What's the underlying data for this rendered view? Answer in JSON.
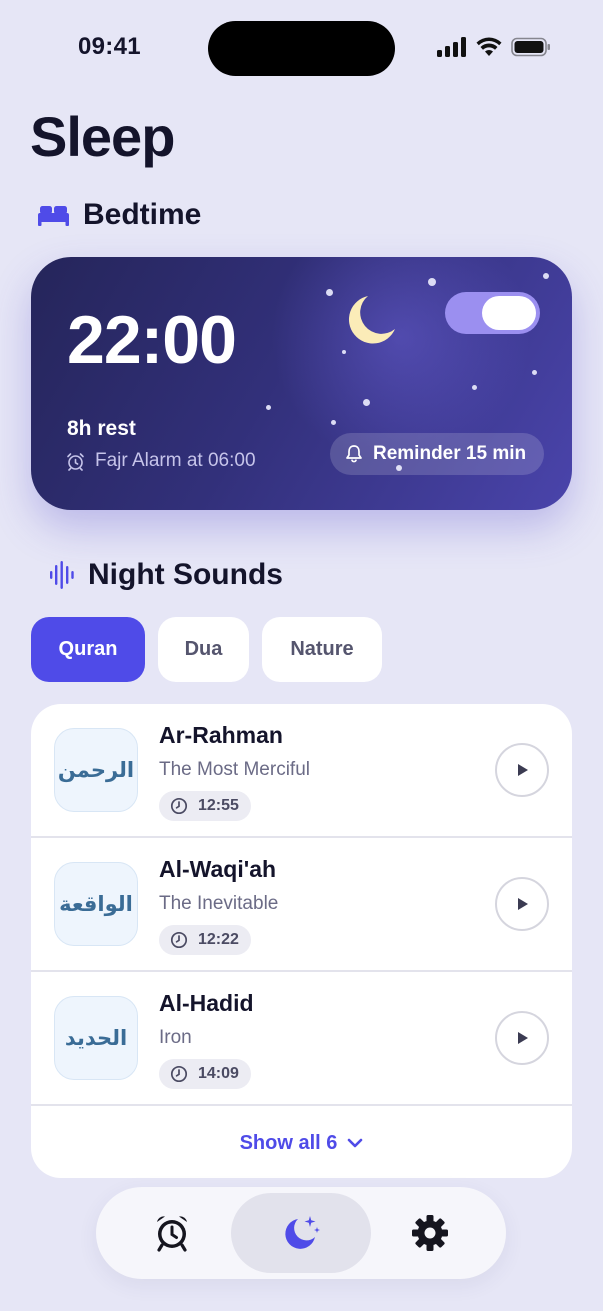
{
  "status_bar": {
    "time": "09:41"
  },
  "page": {
    "title": "Sleep"
  },
  "bedtime": {
    "section_title": "Bedtime",
    "time": "22:00",
    "rest": "8h rest",
    "alarm": "Fajr Alarm at 06:00",
    "reminder": "Reminder 15 min",
    "enabled": true
  },
  "night_sounds": {
    "section_title": "Night Sounds",
    "chips": [
      {
        "label": "Quran",
        "active": true
      },
      {
        "label": "Dua",
        "active": false
      },
      {
        "label": "Nature",
        "active": false
      }
    ],
    "items": [
      {
        "arabic": "الرحمن",
        "title": "Ar-Rahman",
        "subtitle": "The Most Merciful",
        "duration": "12:55"
      },
      {
        "arabic": "الواقعة",
        "title": "Al-Waqi'ah",
        "subtitle": "The Inevitable",
        "duration": "12:22"
      },
      {
        "arabic": "الحديد",
        "title": "Al-Hadid",
        "subtitle": "Iron",
        "duration": "14:09"
      }
    ],
    "show_all": "Show all 6"
  },
  "tab_bar": {
    "tabs": [
      {
        "icon": "alarm-clock-icon",
        "active": false
      },
      {
        "icon": "moon-stars-icon",
        "active": true
      },
      {
        "icon": "gear-icon",
        "active": false
      }
    ]
  },
  "colors": {
    "accent": "#4f4be8",
    "background": "#e6e6f6",
    "card_dark": "#2f2d72",
    "toggle_on": "#9b8ff0"
  }
}
